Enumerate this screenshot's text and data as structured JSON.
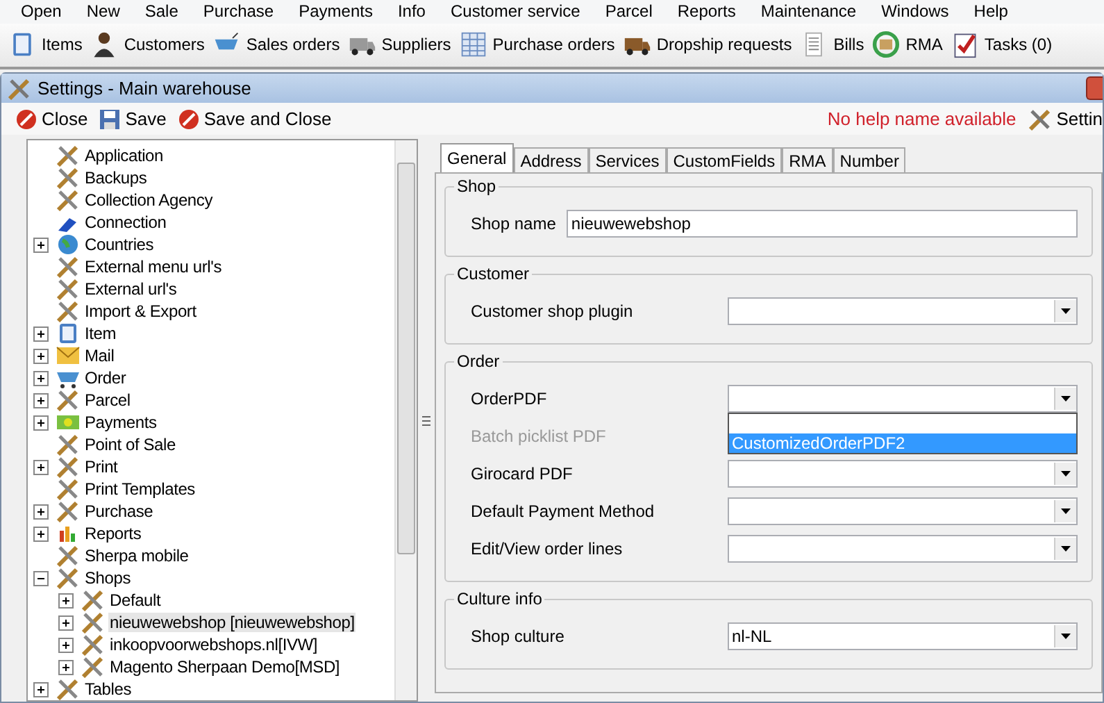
{
  "menu": [
    "Open",
    "New",
    "Sale",
    "Purchase",
    "Payments",
    "Info",
    "Customer service",
    "Parcel",
    "Reports",
    "Maintenance",
    "Windows",
    "Help"
  ],
  "toolbar": [
    "Items",
    "Customers",
    "Sales orders",
    "Suppliers",
    "Purchase orders",
    "Dropship requests",
    "Bills",
    "RMA",
    "Tasks (0)"
  ],
  "window": {
    "title": "Settings - Main warehouse",
    "actions": [
      {
        "label": "Close",
        "kind": "stop"
      },
      {
        "label": "Save",
        "kind": "disk"
      },
      {
        "label": "Save and Close",
        "kind": "stop"
      }
    ],
    "help": "No help name available",
    "settings_link": "Settin"
  },
  "tree": [
    {
      "label": "Application",
      "kind": "tools",
      "selected": false
    },
    {
      "label": "Backups",
      "kind": "tools",
      "selected": false
    },
    {
      "label": "Collection Agency",
      "kind": "tools",
      "selected": false
    },
    {
      "label": "Connection",
      "kind": "plug",
      "selected": false
    },
    {
      "label": "Countries",
      "kind": "globe",
      "expanded": false,
      "selected": false
    },
    {
      "label": "External menu url's",
      "kind": "tools",
      "selected": false
    },
    {
      "label": "External url's",
      "kind": "tools",
      "selected": false
    },
    {
      "label": "Import & Export",
      "kind": "tools",
      "selected": false
    },
    {
      "label": "Item",
      "kind": "box",
      "expanded": false,
      "selected": false
    },
    {
      "label": "Mail",
      "kind": "mail",
      "expanded": false,
      "selected": false
    },
    {
      "label": "Order",
      "kind": "cart",
      "expanded": false,
      "selected": false
    },
    {
      "label": "Parcel",
      "kind": "tools",
      "expanded": false,
      "selected": false
    },
    {
      "label": "Payments",
      "kind": "money",
      "expanded": false,
      "selected": false
    },
    {
      "label": "Point of Sale",
      "kind": "tools",
      "selected": false
    },
    {
      "label": "Print",
      "kind": "tools",
      "expanded": false,
      "selected": false
    },
    {
      "label": "Print Templates",
      "kind": "tools",
      "selected": false
    },
    {
      "label": "Purchase",
      "kind": "tools",
      "expanded": false,
      "selected": false
    },
    {
      "label": "Reports",
      "kind": "chart",
      "expanded": false,
      "selected": false
    },
    {
      "label": "Sherpa mobile",
      "kind": "tools",
      "selected": false
    },
    {
      "label": "Shops",
      "kind": "tools",
      "expanded": true,
      "selected": false,
      "children": [
        {
          "label": "Default",
          "expanded": false,
          "selected": false
        },
        {
          "label": "nieuwewebshop [nieuwewebshop]",
          "expanded": false,
          "selected": true
        },
        {
          "label": "inkoopvoorwebshops.nl[IVW]",
          "expanded": false,
          "selected": false
        },
        {
          "label": "Magento Sherpaan Demo[MSD]",
          "expanded": false,
          "selected": false
        }
      ]
    },
    {
      "label": "Tables",
      "kind": "tools",
      "expanded": false,
      "selected": false
    }
  ],
  "tabs": [
    {
      "label": "General",
      "selected": true
    },
    {
      "label": "Address",
      "selected": false
    },
    {
      "label": "Services",
      "selected": false
    },
    {
      "label": "CustomFields",
      "selected": false
    },
    {
      "label": "RMA",
      "selected": false
    },
    {
      "label": "Number",
      "selected": false
    }
  ],
  "groups": [
    {
      "title": "Shop",
      "fields": [
        {
          "kind": "text",
          "label": "Shop name",
          "value": "nieuwewebshop",
          "disabled": false
        }
      ]
    },
    {
      "title": "Customer",
      "fields": [
        {
          "kind": "combo",
          "label": "Customer shop plugin",
          "disabled": false
        }
      ]
    },
    {
      "title": "Order",
      "fields": [
        {
          "kind": "combo",
          "label": "OrderPDF",
          "disabled": false,
          "open": true,
          "options": [
            {
              "label": "CustomizedOrderPDF2",
              "selected": true
            }
          ]
        },
        {
          "kind": "hidden",
          "label": "Batch picklist PDF",
          "disabled": true
        },
        {
          "kind": "combo",
          "label": "Girocard PDF",
          "disabled": false
        },
        {
          "kind": "combo",
          "label": "Default Payment Method",
          "disabled": false
        },
        {
          "kind": "combo",
          "label": "Edit/View order lines",
          "disabled": false
        }
      ]
    },
    {
      "title": "Culture info",
      "fields": [
        {
          "kind": "combo",
          "label": "Shop culture",
          "value": "nl-NL",
          "disabled": false
        }
      ]
    }
  ]
}
